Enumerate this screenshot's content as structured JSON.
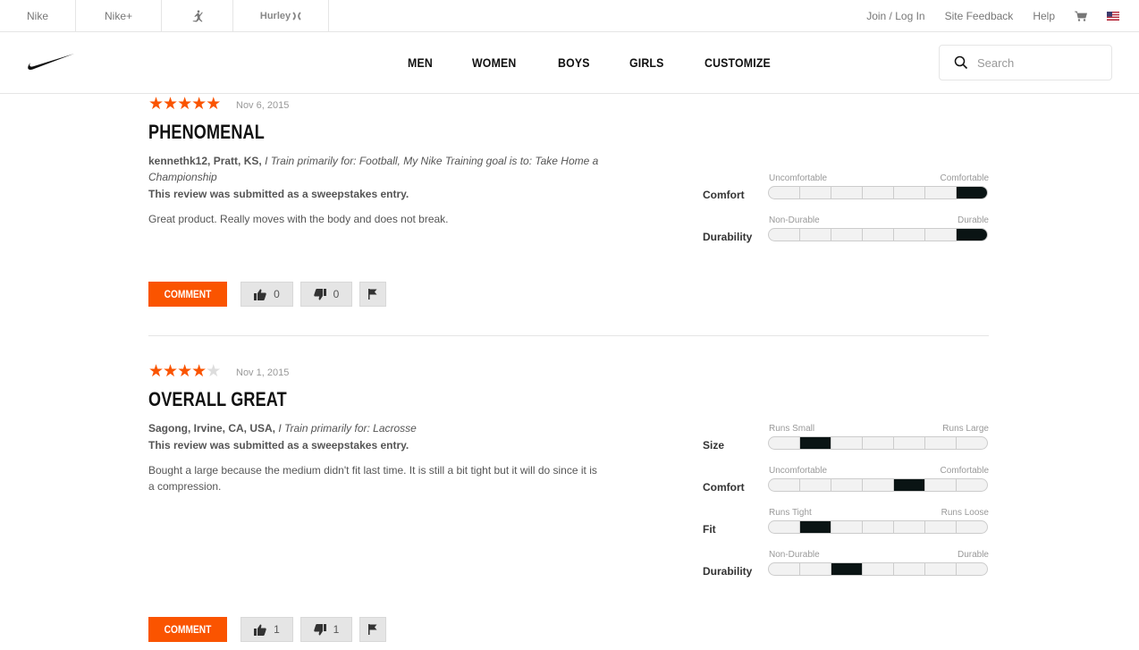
{
  "utility_bar": {
    "brand_tabs": [
      {
        "label": "Nike"
      },
      {
        "label": "Nike+"
      },
      {
        "label": ""
      },
      {
        "label": "Hurley"
      }
    ],
    "links": {
      "join": "Join / Log In",
      "feedback": "Site Feedback",
      "help": "Help"
    },
    "icons": {
      "cart": "cart-icon",
      "flag": "us-flag-icon",
      "jordan": "jumpman-icon"
    }
  },
  "main_nav": {
    "items": [
      {
        "label": "MEN"
      },
      {
        "label": "WOMEN"
      },
      {
        "label": "BOYS"
      },
      {
        "label": "GIRLS"
      },
      {
        "label": "CUSTOMIZE"
      }
    ],
    "search": {
      "placeholder": "Search"
    }
  },
  "colors": {
    "accent": "#fa5400",
    "meter_fill": "#0a1414",
    "star_off": "#dddddd"
  },
  "reviews": [
    {
      "rating": 5,
      "rating_max": 5,
      "date": "Nov 6, 2015",
      "title": "PHENOMENAL",
      "author": "kennethk12, Pratt, KS,",
      "author_detail": "I Train primarily for: Football, My Nike Training goal is to: Take Home a Championship",
      "sweepstakes": "This review was submitted as a sweepstakes entry.",
      "body": "Great product. Really moves with the body and does not break.",
      "meters": [
        {
          "label": "Comfort",
          "low": "Uncomfortable",
          "high": "Comfortable",
          "segments": 7,
          "value": 7
        },
        {
          "label": "Durability",
          "low": "Non-Durable",
          "high": "Durable",
          "segments": 7,
          "value": 7
        }
      ],
      "comment_label": "COMMENT",
      "helpful_count": "0",
      "unhelpful_count": "0"
    },
    {
      "rating": 4,
      "rating_max": 5,
      "date": "Nov 1, 2015",
      "title": "OVERALL GREAT",
      "author": "Sagong, Irvine, CA, USA,",
      "author_detail": "I Train primarily for: Lacrosse",
      "sweepstakes": "This review was submitted as a sweepstakes entry.",
      "body": "Bought a large because the medium didn't fit last time. It is still a bit tight but it will do since it is a compression.",
      "meters": [
        {
          "label": "Size",
          "low": "Runs Small",
          "high": "Runs Large",
          "segments": 7,
          "value": 2
        },
        {
          "label": "Comfort",
          "low": "Uncomfortable",
          "high": "Comfortable",
          "segments": 7,
          "value": 5
        },
        {
          "label": "Fit",
          "low": "Runs Tight",
          "high": "Runs Loose",
          "segments": 7,
          "value": 2
        },
        {
          "label": "Durability",
          "low": "Non-Durable",
          "high": "Durable",
          "segments": 7,
          "value": 3
        }
      ],
      "comment_label": "COMMENT",
      "helpful_count": "1",
      "unhelpful_count": "1"
    }
  ]
}
